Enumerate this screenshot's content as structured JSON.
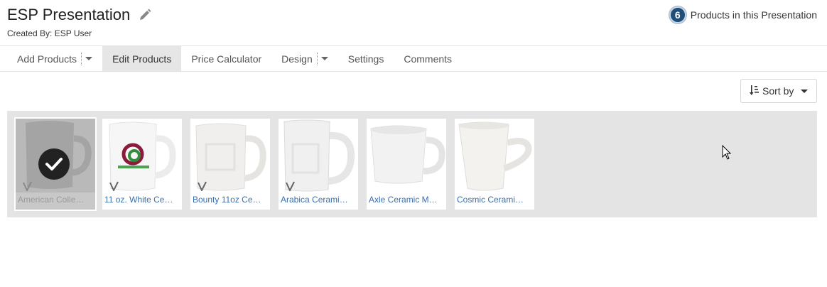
{
  "header": {
    "title": "ESP Presentation",
    "created_by": "Created By: ESP User",
    "product_count": "6",
    "product_count_label": "Products in this Presentation"
  },
  "nav": {
    "items": [
      {
        "label": "Add Products",
        "has_dropdown": true
      },
      {
        "label": "Edit Products",
        "active": true
      },
      {
        "label": "Price Calculator"
      },
      {
        "label": "Design",
        "has_dropdown": true
      },
      {
        "label": "Settings"
      },
      {
        "label": "Comments"
      }
    ]
  },
  "sort": {
    "label": "Sort by"
  },
  "products": [
    {
      "name": "American Colle…",
      "selected": true,
      "icon": "vendor-icon"
    },
    {
      "name": "11 oz. White Ce…",
      "icon": "vendor-icon"
    },
    {
      "name": "Bounty 11oz Ce…",
      "icon": "vendor-icon"
    },
    {
      "name": "Arabica Cerami…",
      "icon": "vendor-icon"
    },
    {
      "name": "Axle Ceramic M…"
    },
    {
      "name": "Cosmic Cerami…"
    }
  ],
  "colors": {
    "badge": "#1f4e79",
    "link": "#3a6fb0",
    "tray": "#e4e4e4"
  }
}
